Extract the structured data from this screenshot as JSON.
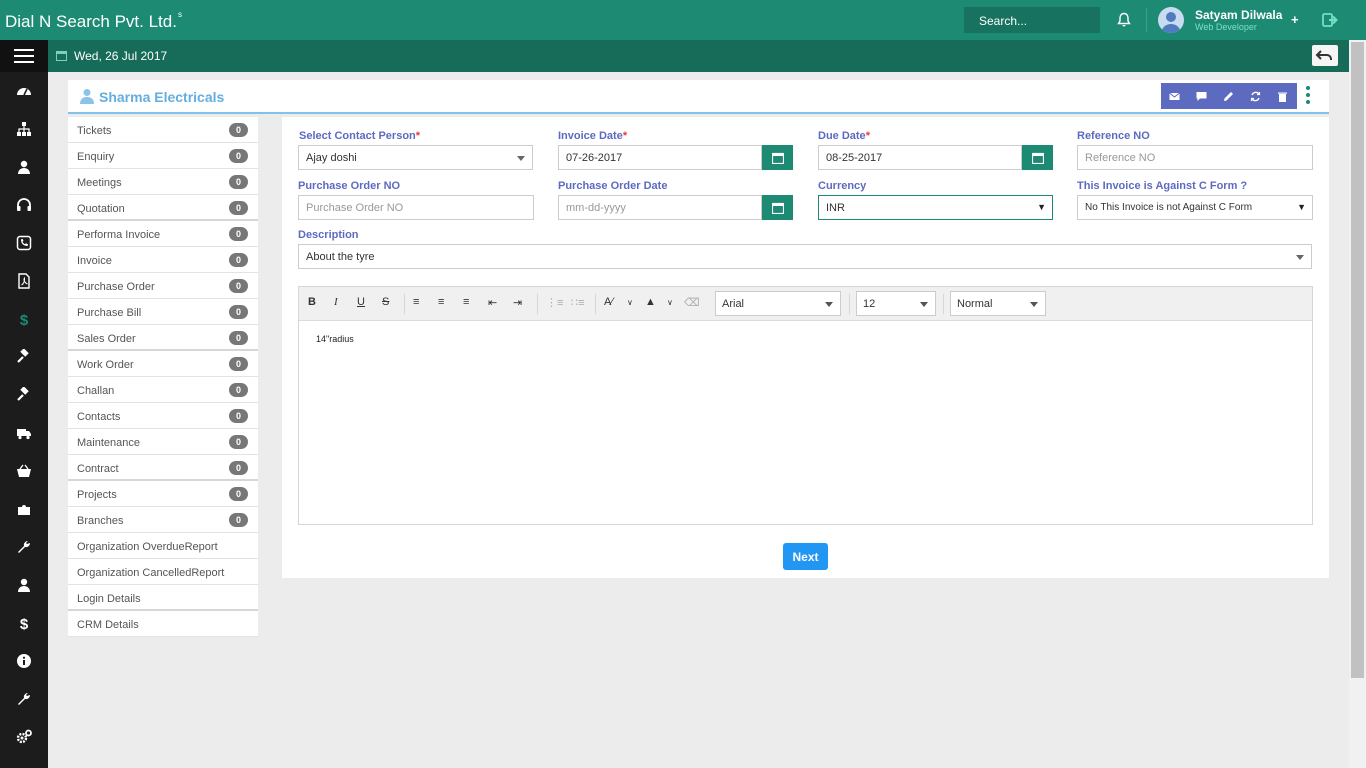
{
  "app": {
    "brand": "Dial N Search Pvt. Ltd.",
    "brand_mark": "s",
    "search_placeholder": "Search...",
    "user_name": "Satyam Dilwala",
    "user_role": "Web Developer",
    "date": "Wed, 26 Jul 2017"
  },
  "colors": {
    "primary": "#1d8a74",
    "dark": "#176b59",
    "accent": "#5c6bc0",
    "title": "#63aee0",
    "button": "#2196f3"
  },
  "header": {
    "org_name": "Sharma Electricals"
  },
  "sidebar_icons": [
    "dashboard-icon",
    "sitemap-icon",
    "user-icon",
    "headset-icon",
    "phone-icon",
    "pdf-icon",
    "dollar-icon",
    "gavel-icon",
    "gavel-icon",
    "truck-icon",
    "basket-icon",
    "puzzle-icon",
    "wrench-icon",
    "user-icon",
    "dollar-icon",
    "info-icon",
    "wrench-icon",
    "cogs-icon"
  ],
  "left_list": [
    {
      "label": "Tickets",
      "count": "0"
    },
    {
      "label": "Enquiry",
      "count": "0"
    },
    {
      "label": "Meetings",
      "count": "0"
    },
    {
      "label": "Quotation",
      "count": "0"
    },
    {
      "label": "Performa Invoice",
      "count": "0"
    },
    {
      "label": "Invoice",
      "count": "0"
    },
    {
      "label": "Purchase Order",
      "count": "0"
    },
    {
      "label": "Purchase Bill",
      "count": "0"
    },
    {
      "label": "Sales Order",
      "count": "0"
    },
    {
      "label": "Work Order",
      "count": "0"
    },
    {
      "label": "Challan",
      "count": "0"
    },
    {
      "label": "Contacts",
      "count": "0"
    },
    {
      "label": "Maintenance",
      "count": "0"
    },
    {
      "label": "Contract",
      "count": "0"
    },
    {
      "label": "Projects",
      "count": "0"
    },
    {
      "label": "Branches",
      "count": "0"
    },
    {
      "label": "Organization OverdueReport"
    },
    {
      "label": "Organization CancelledReport"
    },
    {
      "label": "Login Details"
    },
    {
      "label": "CRM Details"
    }
  ],
  "form": {
    "contact_person": {
      "label": "Select Contact Person",
      "value": "Ajay doshi"
    },
    "invoice_date": {
      "label": "Invoice Date",
      "value": "07-26-2017"
    },
    "due_date": {
      "label": "Due Date",
      "value": "08-25-2017"
    },
    "reference_no": {
      "label": "Reference NO",
      "placeholder": "Reference NO"
    },
    "po_no": {
      "label": "Purchase Order NO",
      "placeholder": "Purchase Order NO"
    },
    "po_date": {
      "label": "Purchase Order Date",
      "placeholder": "mm-dd-yyyy"
    },
    "currency": {
      "label": "Currency",
      "value": "INR"
    },
    "c_form": {
      "label": "This Invoice is Against C Form ?",
      "value": "No This Invoice is not Against C Form"
    },
    "description": {
      "label": "Description",
      "value": "About the tyre"
    },
    "editor": {
      "font": "Arial",
      "size": "12",
      "style": "Normal",
      "content": "14\"radius"
    },
    "next_label": "Next"
  }
}
